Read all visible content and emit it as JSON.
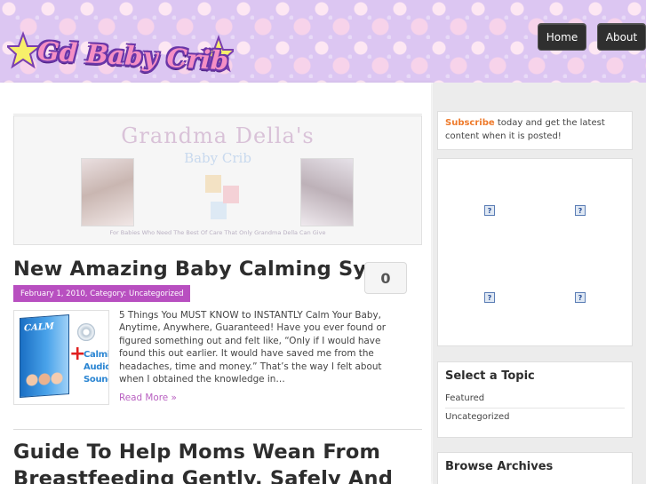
{
  "header": {
    "logo_text": "Gd Baby Crib",
    "nav": {
      "home_label": "Home",
      "about_label": "About"
    }
  },
  "featured_banner": {
    "title": "Grandma Della's",
    "subtitle": "Baby Crib",
    "tagline": "For Babies Who Need The Best Of Care That Only Grandma Della Can Give"
  },
  "posts": [
    {
      "title": "New Amazing Baby Calming System",
      "comment_count": "0",
      "meta": "February 1, 2010, Category: Uncategorized",
      "thumbnail": {
        "box_label": "CALM",
        "plus": "+",
        "caption": "Calming Audio Sounds!"
      },
      "excerpt": "5 Things You MUST KNOW to INSTANTLY Calm Your Baby, Anytime, Anywhere, Guaranteed! Have you ever found or figured something out and felt like, “Only if I would have found this out earlier. It would have saved me from the headaches, time and money.” That’s the way I felt about when I obtained the knowledge in…",
      "read_more": "Read More »"
    },
    {
      "title": "Guide To Help Moms Wean From Breastfeeding Gently, Safely And"
    }
  ],
  "sidebar": {
    "subscribe": {
      "link": "Subscribe",
      "text": " today and get the latest content when it is posted!"
    },
    "ads": [
      "?",
      "?",
      "?",
      "?"
    ],
    "topics": {
      "title": "Select a Topic",
      "items": [
        "Featured",
        "Uncategorized"
      ]
    },
    "archives": {
      "title": "Browse Archives"
    }
  },
  "colors": {
    "accent_purple": "#b84fc0",
    "subscribe_orange": "#ee7a2b",
    "nav_dark": "#2f2f2f"
  }
}
